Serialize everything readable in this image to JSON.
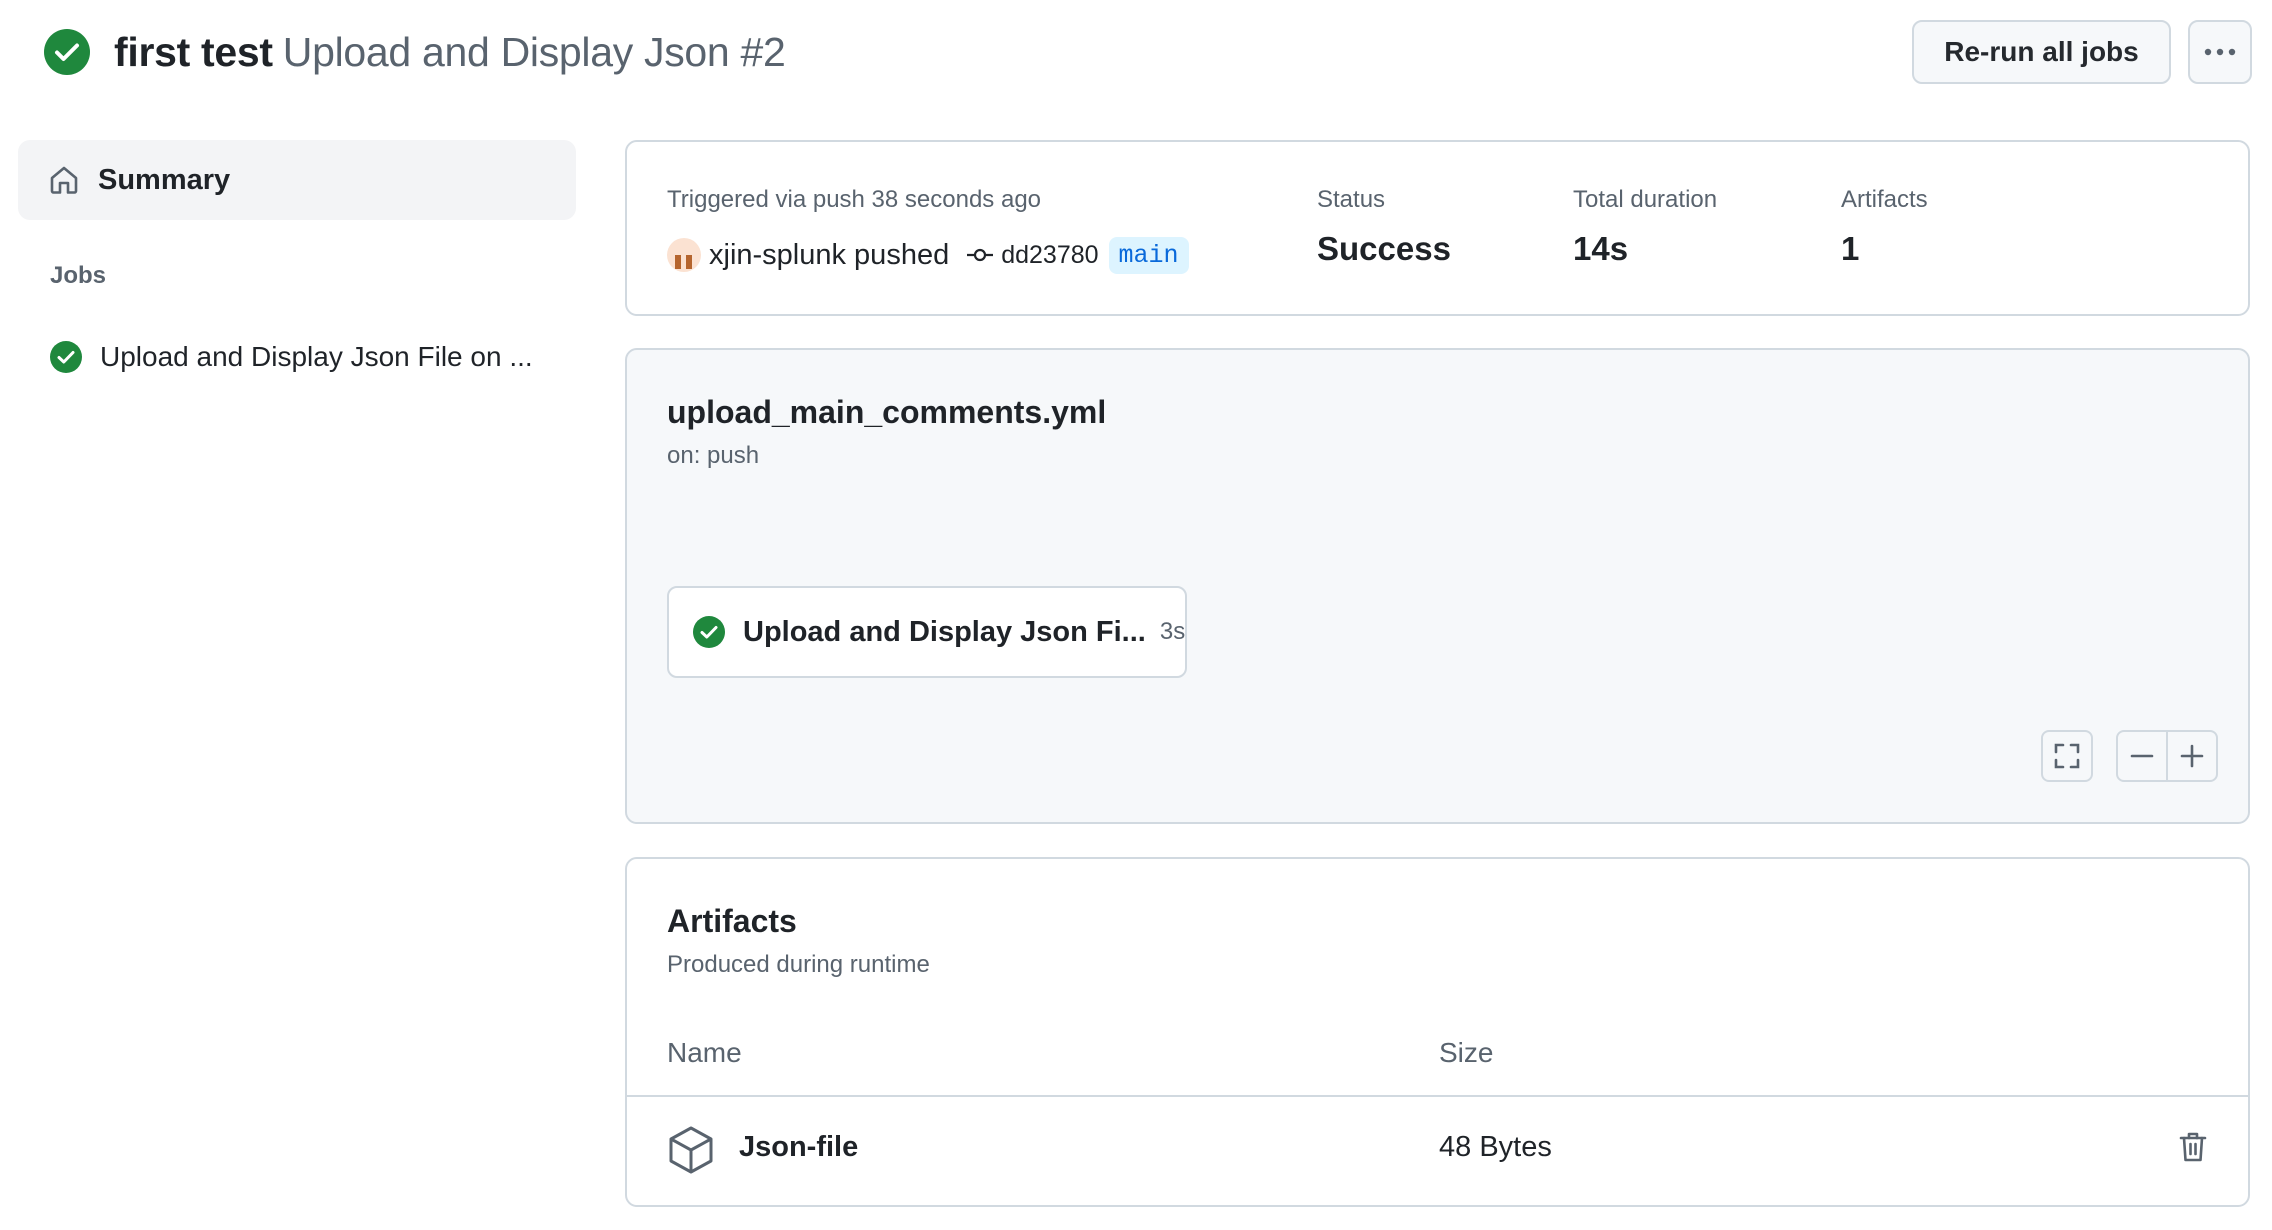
{
  "header": {
    "workflow_name": "first test",
    "run_title": "Upload and Display Json #2",
    "rerun_label": "Re-run all jobs",
    "status_icon": "check-circle-fill-icon",
    "more_icon": "kebab-horizontal-icon"
  },
  "sidebar": {
    "summary_label": "Summary",
    "summary_icon": "home-icon",
    "jobs_heading": "Jobs",
    "jobs": [
      {
        "label": "Upload and Display Json File on ...",
        "status": "success"
      }
    ]
  },
  "run_info": {
    "trigger_text": "Triggered via push 38 seconds ago",
    "actor_text": "xjin-splunk pushed",
    "commit_sha": "dd23780",
    "branch": "main",
    "status_label": "Status",
    "status_value": "Success",
    "duration_label": "Total duration",
    "duration_value": "14s",
    "artifacts_label": "Artifacts",
    "artifacts_value": "1"
  },
  "workflow": {
    "file_name": "upload_main_comments.yml",
    "trigger": "on: push",
    "job_card": {
      "label": "Upload and Display Json Fi...",
      "duration": "3s",
      "status": "success"
    }
  },
  "artifacts": {
    "heading": "Artifacts",
    "subheading": "Produced during runtime",
    "columns": {
      "name": "Name",
      "size": "Size"
    },
    "items": [
      {
        "name": "Json-file",
        "size": "48 Bytes",
        "icon": "package-icon"
      }
    ]
  },
  "colors": {
    "success": "#1f883d",
    "border": "#d1d9e0",
    "muted": "#59636e",
    "accent": "#0969da",
    "branch_bg": "#ddf4ff",
    "panel_bg": "#f6f8fa"
  }
}
